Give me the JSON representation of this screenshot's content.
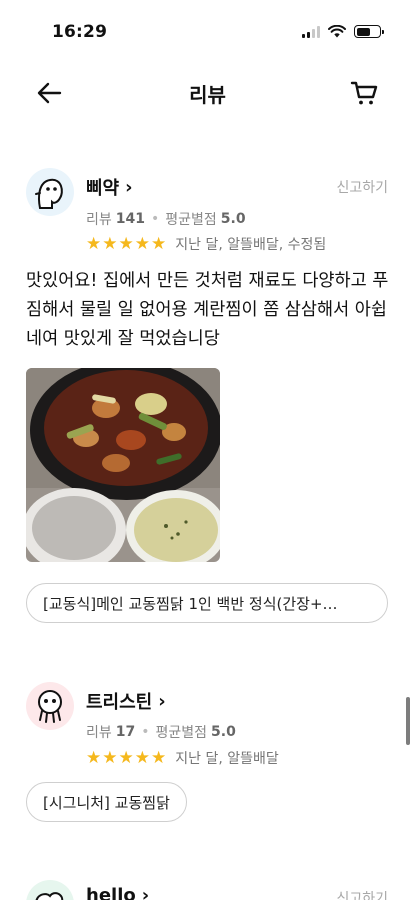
{
  "status_bar": {
    "time": "16:29"
  },
  "nav": {
    "title": "리뷰"
  },
  "reviews": [
    {
      "nickname": "삐약",
      "report_label": "신고하기",
      "review_count_label": "리뷰",
      "review_count": "141",
      "avg_rating_label": "평균별점",
      "avg_rating": "5.0",
      "stars": 5,
      "meta": "지난 달, 알뜰배달, 수정됨",
      "text": "맛있어요! 집에서 만든 것처럼 재료도 다양하고 푸짐해서 물릴 일 없어용 계란찜이 쫌 삼삼해서 아쉽네여 맛있게 잘 먹었습니당",
      "menu": "[교동식]메인 교동찜닭 1인 백반 정식(간장+…"
    },
    {
      "nickname": "트리스틴",
      "review_count_label": "리뷰",
      "review_count": "17",
      "avg_rating_label": "평균별점",
      "avg_rating": "5.0",
      "stars": 5,
      "meta": "지난 달, 알뜰배달",
      "menu": "[시그니처] 교동찜닭"
    },
    {
      "nickname": "hello",
      "report_label": "신고하기"
    }
  ],
  "colors": {
    "star": "#f5b81d",
    "report": "#a8a8a8"
  }
}
